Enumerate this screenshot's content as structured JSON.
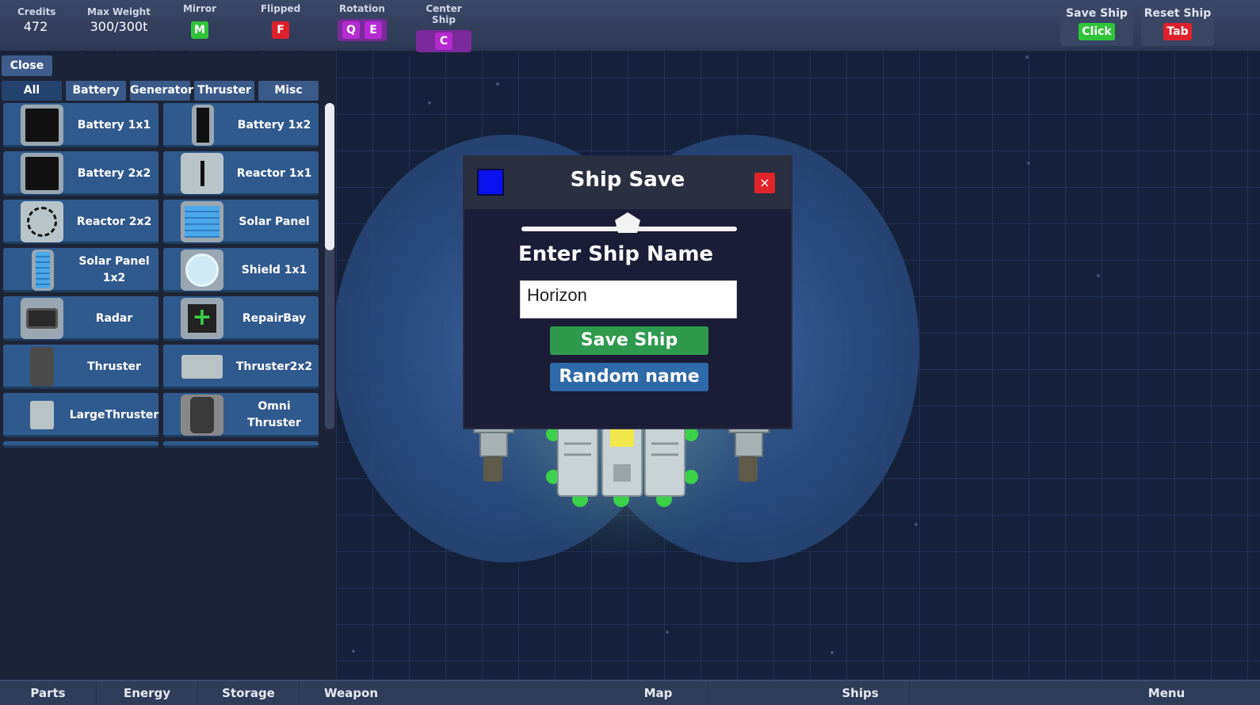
{
  "topbar": {
    "credits_label": "Credits",
    "credits_value": "472",
    "weight_label": "Max Weight",
    "weight_value": "300/300t",
    "mirror_label": "Mirror",
    "mirror_key": "M",
    "flipped_label": "Flipped",
    "flipped_key": "F",
    "rotation_label": "Rotation",
    "rotation_keys": [
      "Q",
      "E"
    ],
    "center_label": "Center Ship",
    "center_key": "C",
    "save_ship_label": "Save Ship",
    "save_ship_key": "Click",
    "reset_ship_label": "Reset Ship",
    "reset_ship_key": "Tab"
  },
  "parts_panel": {
    "close_label": "Close",
    "tabs": [
      "All",
      "Battery",
      "Generator",
      "Thruster",
      "Misc"
    ],
    "active_tab": "All",
    "items": [
      {
        "name": "Battery 1x1",
        "icon": "battery-1x1-icon"
      },
      {
        "name": "Battery 1x2",
        "icon": "battery-1x2-icon"
      },
      {
        "name": "Battery 2x2",
        "icon": "battery-2x2-icon"
      },
      {
        "name": "Reactor 1x1",
        "icon": "reactor-1x1-icon"
      },
      {
        "name": "Reactor 2x2",
        "icon": "reactor-2x2-icon"
      },
      {
        "name": "Solar Panel",
        "icon": "solar-panel-icon"
      },
      {
        "name": "Solar Panel 1x2",
        "icon": "solar-panel-1x2-icon"
      },
      {
        "name": "Shield 1x1",
        "icon": "shield-icon"
      },
      {
        "name": "Radar",
        "icon": "radar-icon"
      },
      {
        "name": "RepairBay",
        "icon": "repair-bay-icon"
      },
      {
        "name": "Thruster",
        "icon": "thruster-icon"
      },
      {
        "name": "Thruster2x2",
        "icon": "thruster-2x2-icon"
      },
      {
        "name": "LargeThruster",
        "icon": "large-thruster-icon"
      },
      {
        "name": "Omni Thruster",
        "icon": "omni-thruster-icon"
      }
    ]
  },
  "modal": {
    "title": "Ship Save",
    "swatch_color": "#0a12f0",
    "close_symbol": "×",
    "field_label": "Enter Ship Name",
    "name_value": "Horizon",
    "save_button": "Save Ship",
    "random_button": "Random name"
  },
  "bottombar": {
    "items": [
      "Parts",
      "Energy",
      "Storage",
      "Weapon",
      "Map",
      "Ships",
      "Menu"
    ]
  }
}
